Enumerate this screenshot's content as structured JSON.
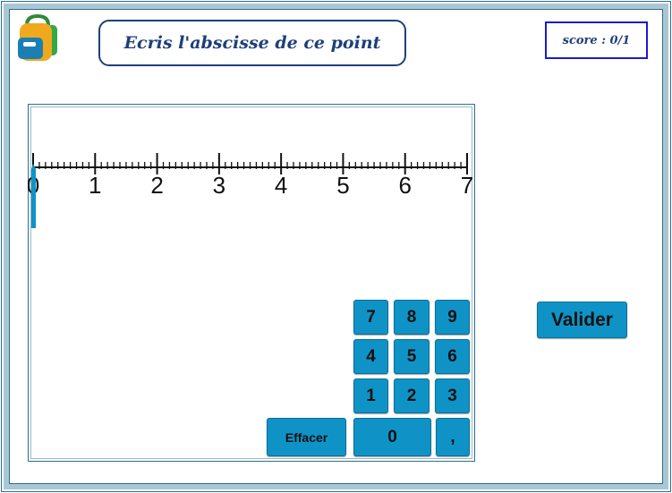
{
  "header": {
    "title": "Ecris l'abscisse de ce point",
    "score": "score : 0/1",
    "logo_icon": "backpack-icon"
  },
  "number_line": {
    "labels": [
      "0",
      "1",
      "2",
      "3",
      "4",
      "5",
      "6",
      "7"
    ],
    "min": 0,
    "max": 7,
    "subdivisions": 10,
    "marker_value": 0
  },
  "keypad": {
    "rows": [
      [
        "7",
        "8",
        "9"
      ],
      [
        "4",
        "5",
        "6"
      ],
      [
        "1",
        "2",
        "3"
      ]
    ],
    "zero": "0",
    "comma": ",",
    "clear": "Effacer"
  },
  "validate_label": "Valider",
  "colors": {
    "accent": "#0f93c6",
    "title_text": "#1e3f7a",
    "score_border": "#1a1ad6",
    "frame": "#a9c7d4"
  }
}
